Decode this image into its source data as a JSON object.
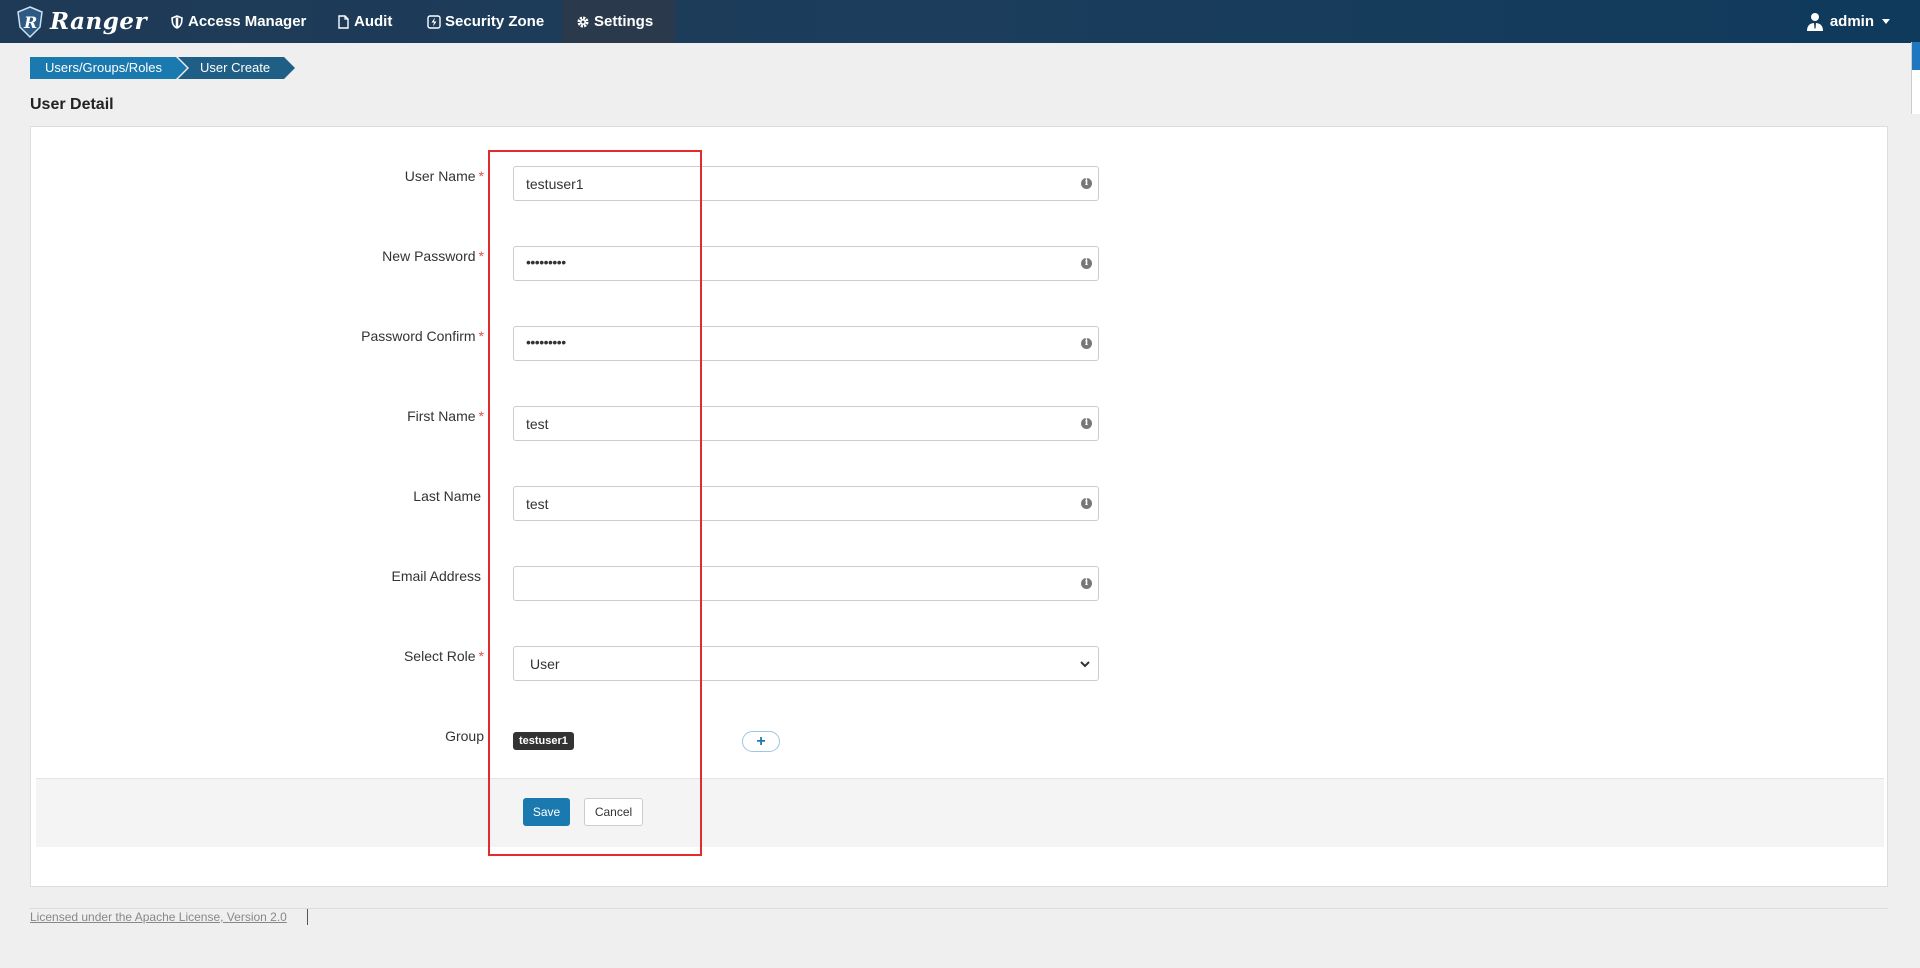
{
  "navbar": {
    "brand": "Ranger",
    "items": [
      {
        "label": "Access Manager",
        "icon": "shield-icon"
      },
      {
        "label": "Audit",
        "icon": "file-icon"
      },
      {
        "label": "Security Zone",
        "icon": "lightning-icon"
      },
      {
        "label": "Settings",
        "icon": "gear-icon",
        "active": true
      }
    ],
    "user": "admin"
  },
  "breadcrumb": [
    "Users/Groups/Roles",
    "User Create"
  ],
  "page_title": "User Detail",
  "form": {
    "fields": [
      {
        "label": "User Name",
        "required": "*",
        "value": "testuser1"
      },
      {
        "label": "New Password",
        "required": "*",
        "value": "•••••••••"
      },
      {
        "label": "Password Confirm",
        "required": "*",
        "value": "•••••••••"
      },
      {
        "label": "First Name",
        "required": "*",
        "value": "test"
      },
      {
        "label": "Last Name",
        "required": "",
        "value": "test"
      },
      {
        "label": "Email Address",
        "required": "",
        "value": ""
      }
    ],
    "role": {
      "label": "Select Role",
      "required": "*",
      "value": "User"
    },
    "group": {
      "label": "Group",
      "tag": "testuser1",
      "add": "+"
    },
    "info_glyph": "i",
    "save": "Save",
    "cancel": "Cancel"
  },
  "footer": {
    "license": "Licensed under the Apache License, Version 2.0"
  },
  "colors": {
    "navbar": "#1c3d5c",
    "primary": "#1a7ab0",
    "highlight": "#e32b2b",
    "required": "#d9534f"
  }
}
